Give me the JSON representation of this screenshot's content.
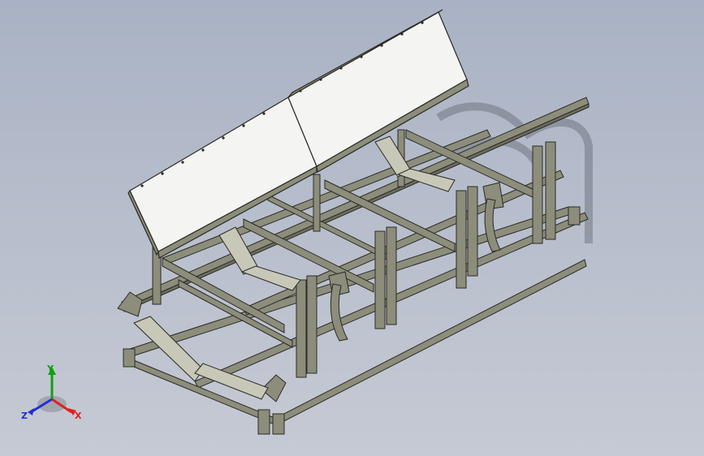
{
  "viewport": {
    "background_top": "#a9b2c4",
    "background_bottom": "#c6cad4"
  },
  "model": {
    "frame_color": "#8d8d7c",
    "frame_edge_color": "#2a2a24",
    "cover_color": "#f4f4f2",
    "roller_color": "#c8c8b8"
  },
  "triad": {
    "x_label": "X",
    "y_label": "Y",
    "z_label": "Z",
    "x_color": "#e02020",
    "y_color": "#10a010",
    "z_color": "#2030d0"
  }
}
